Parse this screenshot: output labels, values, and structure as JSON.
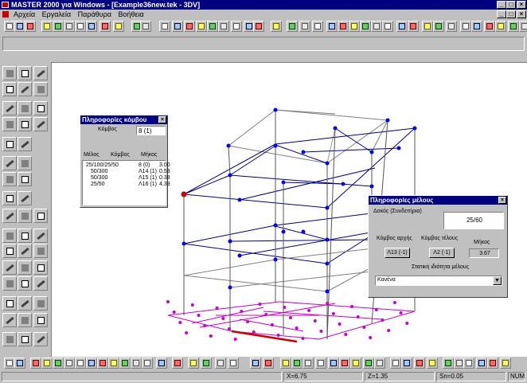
{
  "window": {
    "title": "MASTER 2000 για Windows - [Example36new.tek - 3DV]"
  },
  "menu": {
    "items": [
      "Αρχεία",
      "Εργαλεία",
      "Παράθυρα",
      "Βοήθεια"
    ]
  },
  "node_panel": {
    "title": "Πληροφορίες κόμβου",
    "node_label": "Κόμβος",
    "node_value": "8 (1)",
    "col_member": "Μέλος",
    "col_node": "Κόμβος",
    "col_length": "Μήκος",
    "rows": [
      {
        "member": "25/100/25/50",
        "node": "8 (0)",
        "length": "3.00"
      },
      {
        "member": "50/300",
        "node": "Λ14 (1)",
        "length": "0.53"
      },
      {
        "member": "50/300",
        "node": "Λ15 (1)",
        "length": "0.38"
      },
      {
        "member": "25/50",
        "node": "Λ16 (1)",
        "length": "4.39"
      }
    ]
  },
  "member_panel": {
    "title": "Πληροφορίες μέλους",
    "type_label": "Δοκός (Συνδετήρια)",
    "section_value": "25/60",
    "start_node_label": "Κόμβος αρχής",
    "end_node_label": "Κόμβος τέλους",
    "length_label": "Μήκος",
    "start_node_value": "Λ13 (-1)",
    "end_node_value": "Λ2 (-1)",
    "length_value": "3.67",
    "static_prop_label": "Στατική ιδιότητα μέλους",
    "static_prop_value": "Κανένα"
  },
  "status": {
    "x": "X=6.75",
    "z": "Z=1.35",
    "sn": "Sn=0.05",
    "num": "NUM"
  },
  "colors": {
    "titlebar": "#000080",
    "frame": "#000080",
    "node": "#0000ff",
    "base_node": "#cc00cc",
    "selected_member": "#cc0000"
  }
}
